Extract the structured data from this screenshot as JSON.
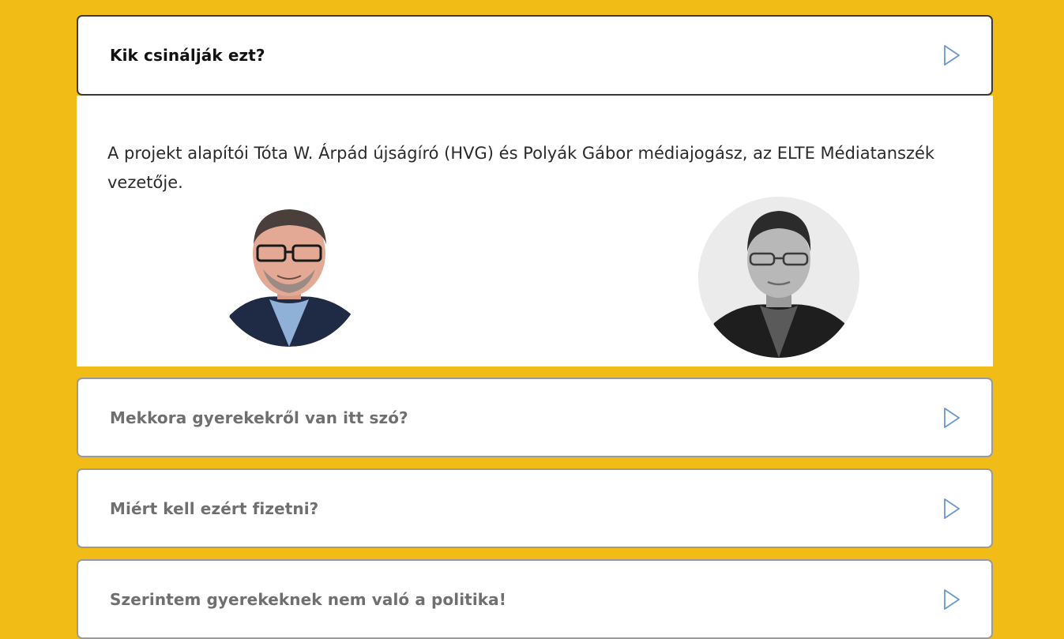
{
  "faq": {
    "open_item": {
      "question": "Kik csinálják ezt?",
      "answer": "A projekt alapítói Tóta W. Árpád újságíró (HVG) és Polyák Gábor médiajogász, az ELTE Médiatanszék vezetője."
    },
    "items": [
      {
        "question": "Mekkora gyerekekről van itt szó?"
      },
      {
        "question": "Miért kell ezért fizetni?"
      },
      {
        "question": "Szerintem gyerekeknek nem való a politika!"
      }
    ]
  },
  "icons": {
    "arrow": "play-outline-icon"
  },
  "colors": {
    "background": "#f2bc17",
    "arrow": "#6b97cf",
    "card": "#ffffff"
  }
}
